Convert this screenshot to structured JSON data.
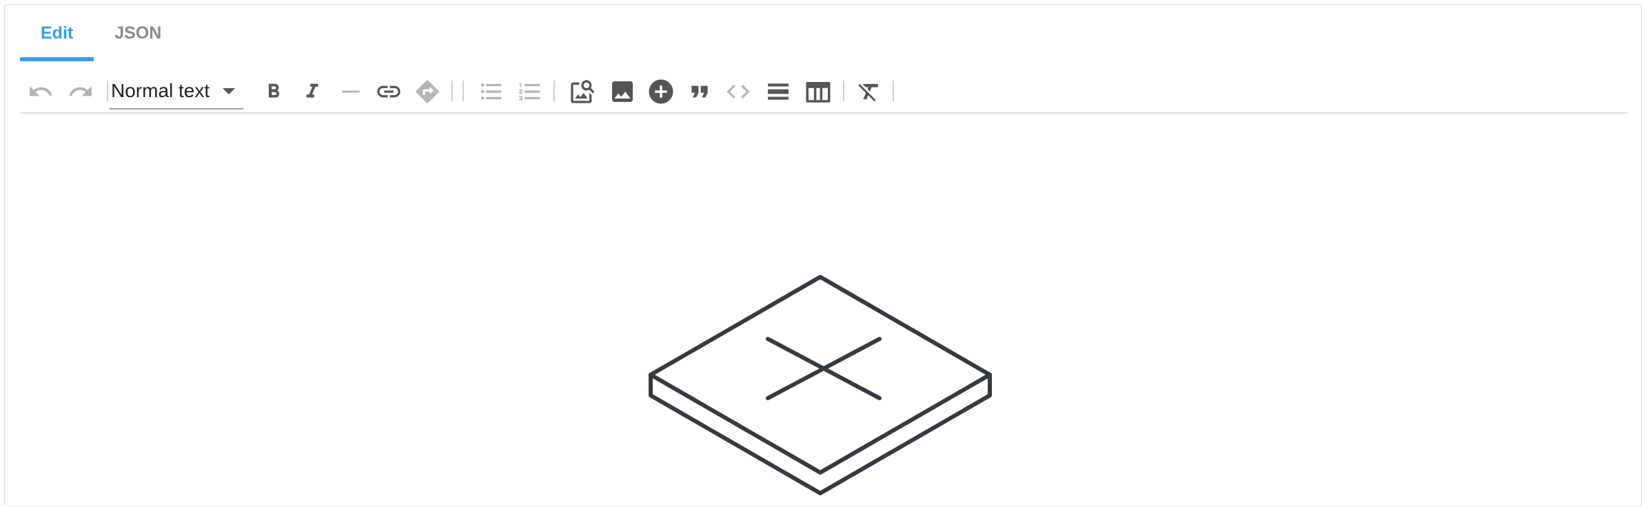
{
  "tabs": [
    {
      "label": "Edit",
      "active": true
    },
    {
      "label": "JSON",
      "active": false
    }
  ],
  "toolbar": {
    "block_type_selected": "Normal text",
    "buttons": [
      {
        "name": "undo-icon",
        "enabled": false
      },
      {
        "name": "redo-icon",
        "enabled": false
      },
      {
        "name": "bold-icon",
        "enabled": true
      },
      {
        "name": "italic-icon",
        "enabled": true
      },
      {
        "name": "strikethrough-icon",
        "enabled": false
      },
      {
        "name": "link-icon",
        "enabled": true
      },
      {
        "name": "anchor-icon",
        "enabled": false
      },
      {
        "name": "bullet-list-icon",
        "enabled": false
      },
      {
        "name": "numbered-list-icon",
        "enabled": false
      },
      {
        "name": "image-search-icon",
        "enabled": true
      },
      {
        "name": "image-icon",
        "enabled": true
      },
      {
        "name": "add-circle-icon",
        "enabled": true
      },
      {
        "name": "quote-icon",
        "enabled": true
      },
      {
        "name": "code-icon",
        "enabled": false
      },
      {
        "name": "horizontal-rule-icon",
        "enabled": true
      },
      {
        "name": "table-icon",
        "enabled": true
      },
      {
        "name": "clear-format-icon",
        "enabled": true
      }
    ]
  },
  "colors": {
    "accent": "#3d9be9",
    "icon_active": "#555555",
    "icon_disabled": "#b4b4b4",
    "illustration_stroke": "#343a40"
  }
}
